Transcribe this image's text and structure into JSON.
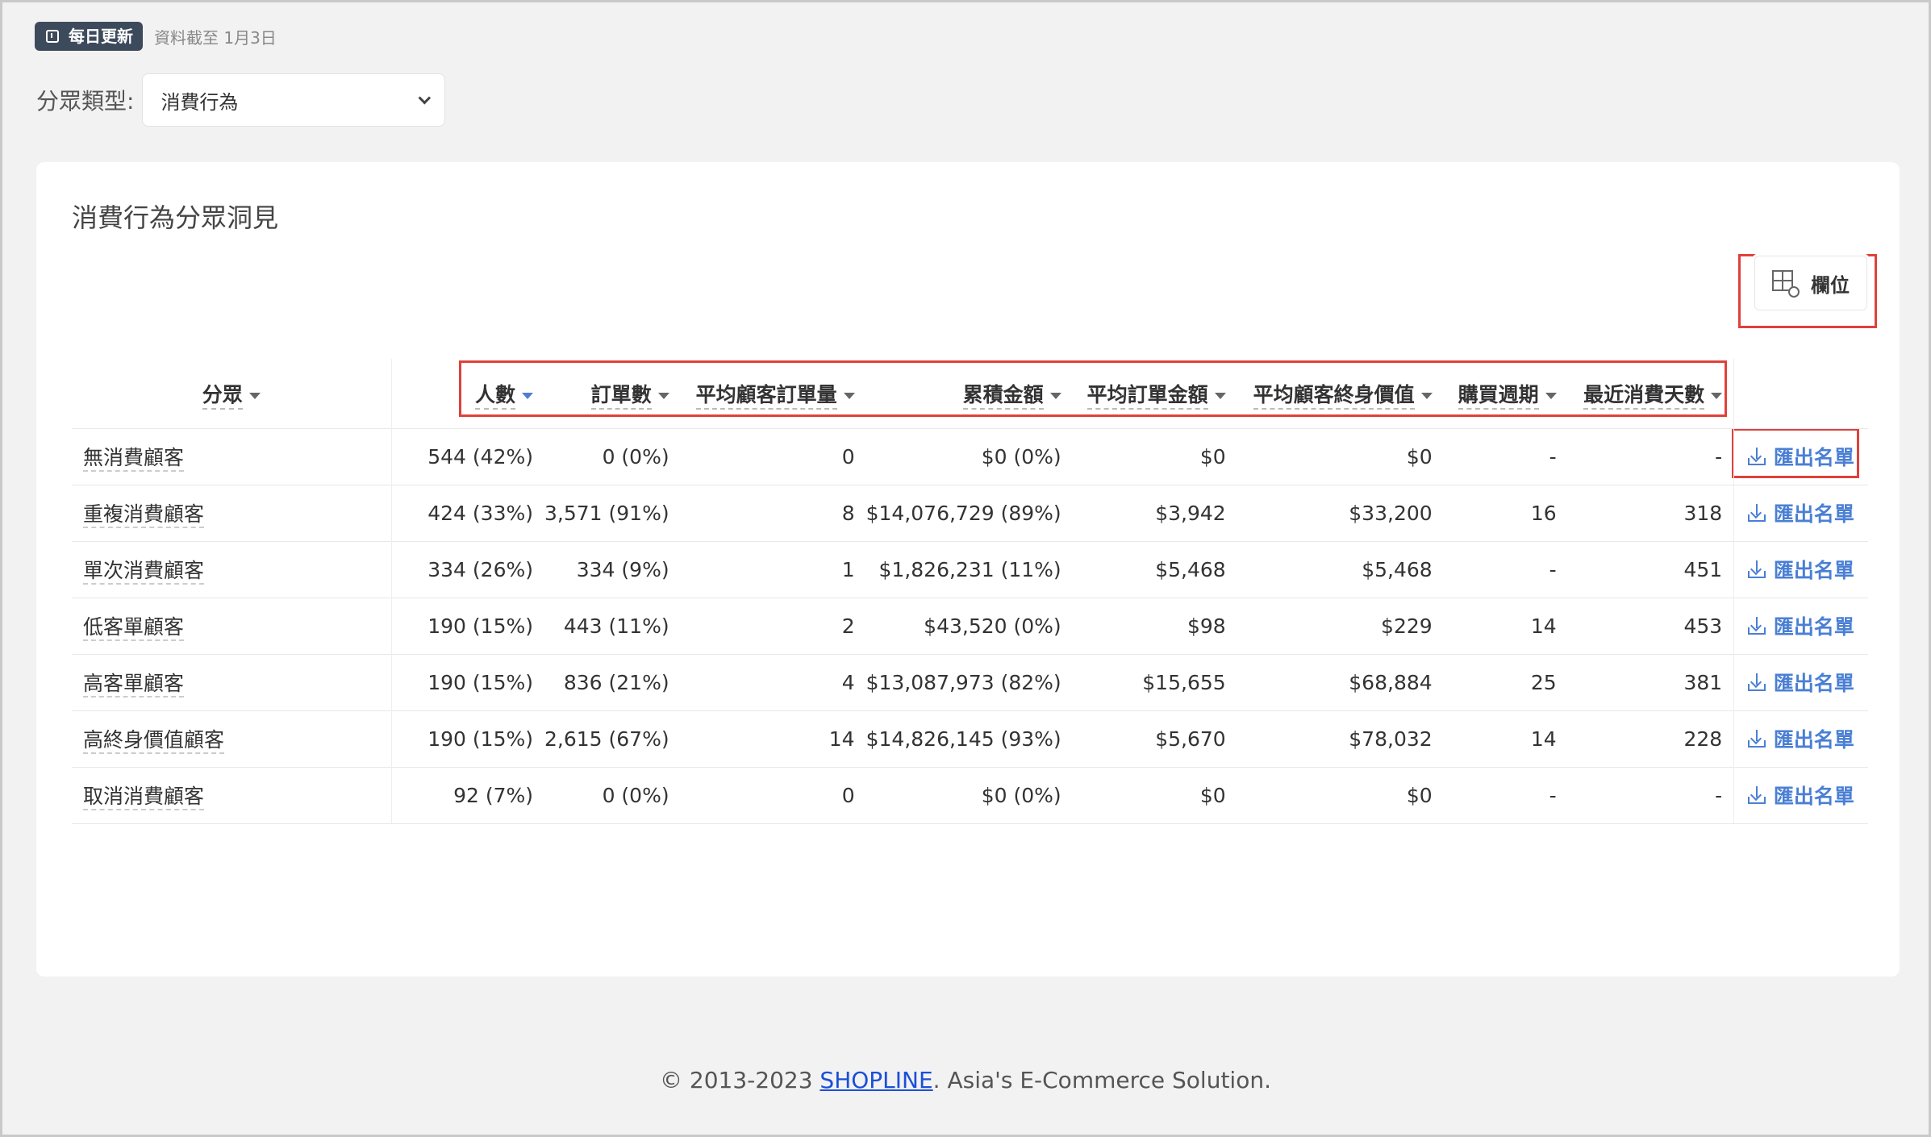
{
  "header": {
    "badge": "每日更新",
    "data_date": "資料截至 1月3日"
  },
  "filter": {
    "label": "分眾類型:",
    "selected": "消費行為"
  },
  "card": {
    "title": "消費行為分眾洞見",
    "columns_button": "欄位"
  },
  "table": {
    "headers": [
      "分眾",
      "人數",
      "訂單數",
      "平均顧客訂單量",
      "累積金額",
      "平均訂單金額",
      "平均顧客終身價值",
      "購買週期",
      "最近消費天數"
    ],
    "rows": [
      {
        "segment": "無消費顧客",
        "people": "544 (42%)",
        "orders": "0 (0%)",
        "avg_orders": "0",
        "total": "$0 (0%)",
        "aov": "$0",
        "clv": "$0",
        "cycle": "-",
        "recency": "-",
        "action": "匯出名單"
      },
      {
        "segment": "重複消費顧客",
        "people": "424 (33%)",
        "orders": "3,571 (91%)",
        "avg_orders": "8",
        "total": "$14,076,729 (89%)",
        "aov": "$3,942",
        "clv": "$33,200",
        "cycle": "16",
        "recency": "318",
        "action": "匯出名單"
      },
      {
        "segment": "單次消費顧客",
        "people": "334 (26%)",
        "orders": "334 (9%)",
        "avg_orders": "1",
        "total": "$1,826,231 (11%)",
        "aov": "$5,468",
        "clv": "$5,468",
        "cycle": "-",
        "recency": "451",
        "action": "匯出名單"
      },
      {
        "segment": "低客單顧客",
        "people": "190 (15%)",
        "orders": "443 (11%)",
        "avg_orders": "2",
        "total": "$43,520 (0%)",
        "aov": "$98",
        "clv": "$229",
        "cycle": "14",
        "recency": "453",
        "action": "匯出名單"
      },
      {
        "segment": "高客單顧客",
        "people": "190 (15%)",
        "orders": "836 (21%)",
        "avg_orders": "4",
        "total": "$13,087,973 (82%)",
        "aov": "$15,655",
        "clv": "$68,884",
        "cycle": "25",
        "recency": "381",
        "action": "匯出名單"
      },
      {
        "segment": "高終身價值顧客",
        "people": "190 (15%)",
        "orders": "2,615 (67%)",
        "avg_orders": "14",
        "total": "$14,826,145 (93%)",
        "aov": "$5,670",
        "clv": "$78,032",
        "cycle": "14",
        "recency": "228",
        "action": "匯出名單"
      },
      {
        "segment": "取消消費顧客",
        "people": "92 (7%)",
        "orders": "0 (0%)",
        "avg_orders": "0",
        "total": "$0 (0%)",
        "aov": "$0",
        "clv": "$0",
        "cycle": "-",
        "recency": "-",
        "action": "匯出名單"
      }
    ]
  },
  "footer": {
    "prefix": "© 2013-2023 ",
    "link": "SHOPLINE",
    "suffix": ". Asia's E-Commerce Solution."
  },
  "colors": {
    "accent": "#4a7fd4",
    "badge_bg": "#3d4a5c",
    "highlight": "#e0413a"
  }
}
